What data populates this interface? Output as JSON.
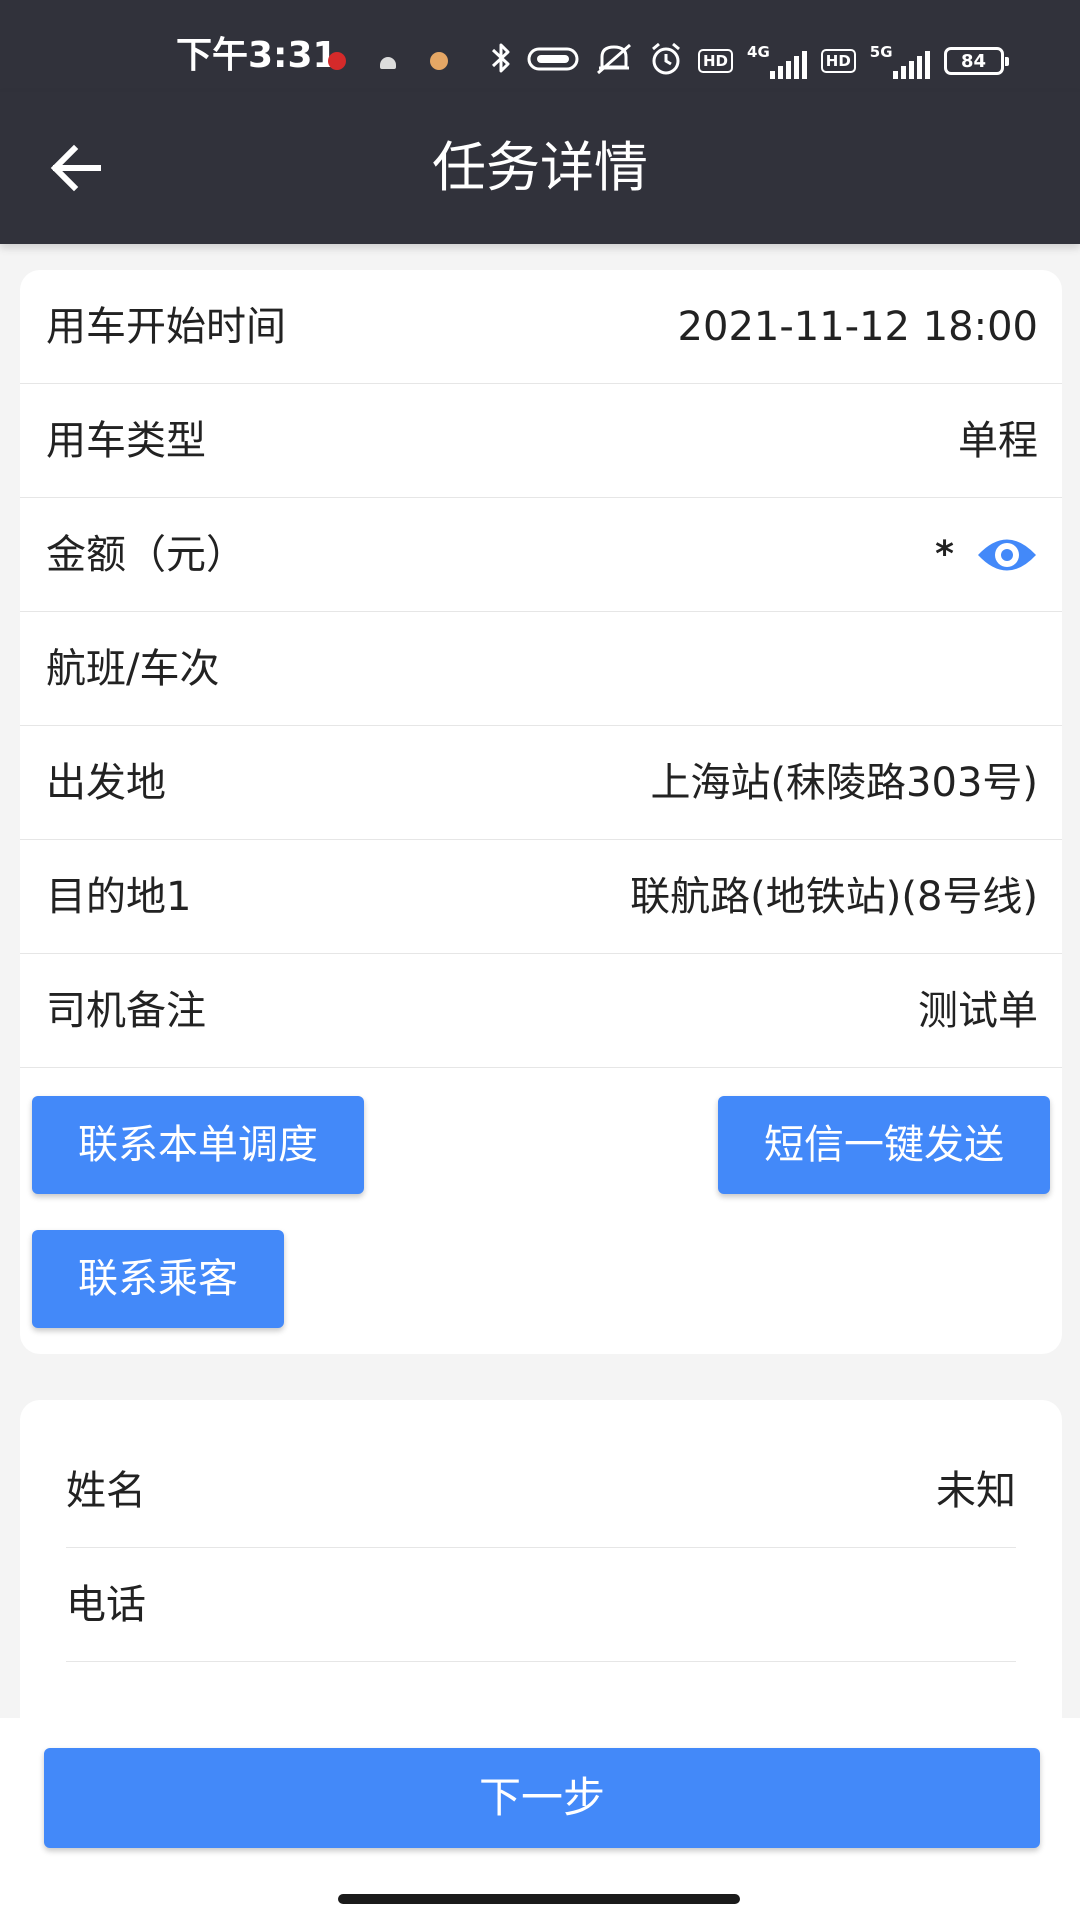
{
  "status_bar": {
    "time": "下午3:31",
    "network_1": "4G",
    "network_2": "5G",
    "hd_1": "HD",
    "hd_2": "HD",
    "battery": "84"
  },
  "header": {
    "title": "任务详情",
    "back_icon": "arrow-left-icon"
  },
  "trip": {
    "rows": [
      {
        "label": "用车开始时间",
        "value": "2021-11-12 18:00"
      },
      {
        "label": "用车类型",
        "value": "单程"
      },
      {
        "label": "金额（元）",
        "value": "*"
      },
      {
        "label": "航班/车次",
        "value": ""
      },
      {
        "label": "出发地",
        "value": "上海站(秣陵路303号)"
      },
      {
        "label": "目的地1",
        "value": "联航路(地铁站)(8号线)"
      },
      {
        "label": "司机备注",
        "value": "测试单"
      }
    ],
    "amount_toggle_icon": "eye-icon"
  },
  "actions": {
    "contact_dispatch": "联系本单调度",
    "sms_send": "短信一键发送",
    "contact_passenger": "联系乘客"
  },
  "passenger": {
    "rows": [
      {
        "label": "姓名",
        "value": "未知"
      },
      {
        "label": "电话",
        "value": ""
      }
    ]
  },
  "footer": {
    "next_label": "下一步"
  },
  "colors": {
    "header_bg": "#31323b",
    "accent": "#4389f9",
    "page_bg": "#f4f4f4"
  }
}
